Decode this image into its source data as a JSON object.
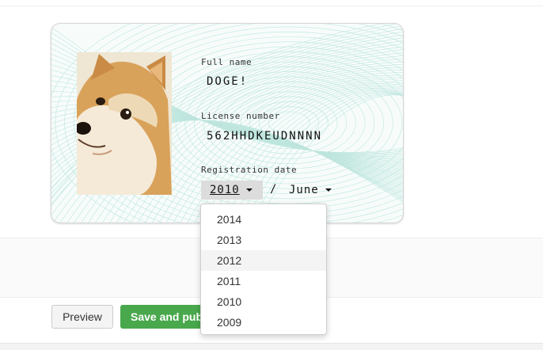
{
  "license": {
    "full_name_label": "Full name",
    "full_name_value": "DOGE!",
    "license_number_label": "License number",
    "license_number_value": "562HHDKEUDNNNN",
    "registration_date_label": "Registration date",
    "year_selected": "2010",
    "date_separator": "/",
    "month_selected": "June"
  },
  "year_dropdown": {
    "options": [
      "2014",
      "2013",
      "2012",
      "2011",
      "2010",
      "2009"
    ],
    "highlighted": "2012"
  },
  "actions": {
    "preview_label": "Preview",
    "save_label": "Save and publish"
  },
  "colors": {
    "save_button": "#49a84c",
    "guilloche": "#8fd3c6"
  },
  "icons": {
    "caret": "caret-down-icon"
  }
}
